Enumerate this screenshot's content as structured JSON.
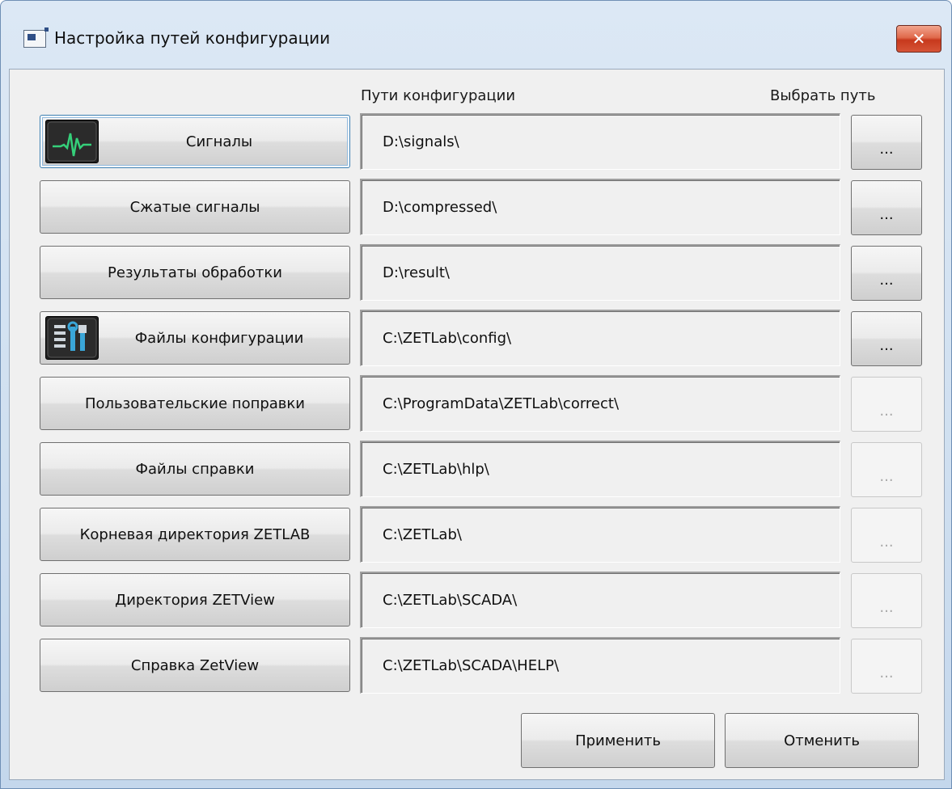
{
  "window": {
    "title": "Настройка путей конфигурации",
    "close_label": "✕"
  },
  "headers": {
    "paths": "Пути конфигурации",
    "choose": "Выбрать путь"
  },
  "rows": [
    {
      "label": "Сигналы",
      "path": "D:\\signals\\",
      "browse": "...",
      "icon": "signal-waveform-icon",
      "browse_enabled": true
    },
    {
      "label": "Сжатые сигналы",
      "path": "D:\\compressed\\",
      "browse": "...",
      "browse_enabled": true
    },
    {
      "label": "Результаты обработки",
      "path": "D:\\result\\",
      "browse": "...",
      "browse_enabled": true
    },
    {
      "label": "Файлы конфигурации",
      "path": "C:\\ZETLab\\config\\",
      "browse": "...",
      "icon": "tools-settings-icon",
      "browse_enabled": true
    },
    {
      "label": "Пользовательские поправки",
      "path": "C:\\ProgramData\\ZETLab\\correct\\",
      "browse": "...",
      "browse_enabled": false
    },
    {
      "label": "Файлы справки",
      "path": "C:\\ZETLab\\hlp\\",
      "browse": "...",
      "browse_enabled": false
    },
    {
      "label": "Корневая директория ZETLAB",
      "path": "C:\\ZETLab\\",
      "browse": "...",
      "browse_enabled": false
    },
    {
      "label": "Директория ZETView",
      "path": "C:\\ZETLab\\SCADA\\",
      "browse": "...",
      "browse_enabled": false
    },
    {
      "label": "Справка ZetView",
      "path": "C:\\ZETLab\\SCADA\\HELP\\",
      "browse": "...",
      "browse_enabled": false
    }
  ],
  "actions": {
    "apply": "Применить",
    "cancel": "Отменить"
  },
  "colors": {
    "waveform": "#35d07a",
    "tool_accent": "#3aa6d8"
  }
}
